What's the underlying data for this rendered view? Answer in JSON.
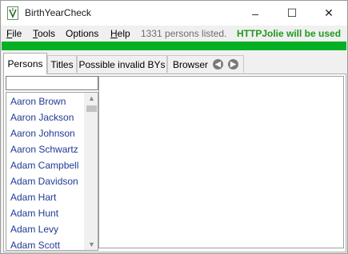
{
  "window": {
    "title": "BirthYearCheck",
    "icon": "app-icon",
    "controls": {
      "minimize": "–",
      "maximize": "☐",
      "close": "✕"
    }
  },
  "menu": {
    "file": {
      "mnemonic": "F",
      "rest": "ile"
    },
    "tools": {
      "mnemonic": "T",
      "rest": "ools"
    },
    "options": {
      "label": "Options"
    },
    "help": {
      "mnemonic": "H",
      "rest": "elp"
    }
  },
  "status": {
    "count_text": "1331 persons listed.",
    "http_text": "HTTPJolie will be used",
    "progress_color": "#06b025",
    "progress": 1.0
  },
  "tabs": {
    "persons": "Persons",
    "titles": "Titles",
    "invalid": "Possible invalid BYs",
    "browser": "Browser",
    "active": "Persons"
  },
  "search": {
    "value": "",
    "placeholder": ""
  },
  "persons": [
    "Aaron Brown",
    "Aaron Jackson",
    "Aaron Johnson",
    "Aaron Schwartz",
    "Adam Campbell",
    "Adam Davidson",
    "Adam Hart",
    "Adam Hunt",
    "Adam Levy",
    "Adam Scott"
  ],
  "colors": {
    "link": "#1f3a93",
    "http_ok": "#1e9a1e"
  }
}
